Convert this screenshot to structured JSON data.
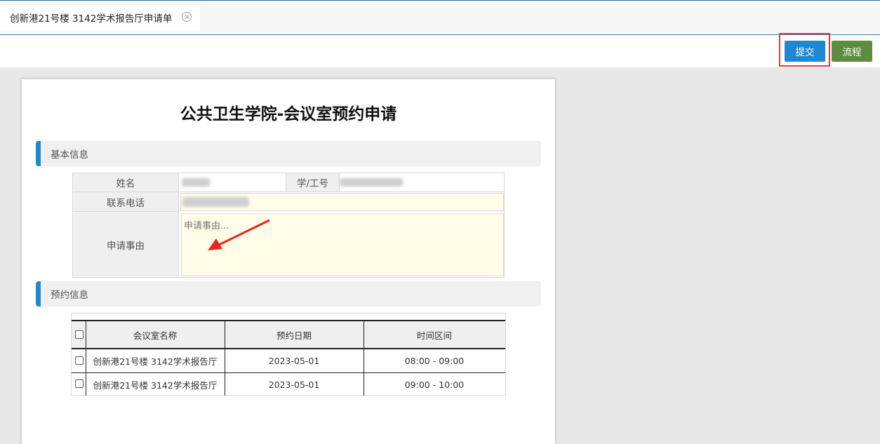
{
  "tab": {
    "title": "创新港21号楼 3142学术报告厅申请单"
  },
  "toolbar": {
    "submit_label": "提交",
    "flow_label": "流程"
  },
  "form": {
    "title": "公共卫生学院-会议室预约申请",
    "section_basic": "基本信息",
    "section_booking": "预约信息",
    "name_label": "姓名",
    "id_label": "学/工号",
    "phone_label": "联系电话",
    "reason_label": "申请事由",
    "reason_placeholder": "申请事由..."
  },
  "booking_table": {
    "headers": [
      "会议室名称",
      "预约日期",
      "时间区间"
    ],
    "rows": [
      {
        "room": "创新港21号楼 3142学术报告厅",
        "date": "2023-05-01",
        "time": "08:00 - 09:00"
      },
      {
        "room": "创新港21号楼 3142学术报告厅",
        "date": "2023-05-01",
        "time": "09:00 - 10:00"
      }
    ]
  },
  "colors": {
    "accent": "#1e88d2",
    "flow_button": "#5b8c3f",
    "highlight": "#e53935",
    "field_yellow": "#fffde8"
  }
}
